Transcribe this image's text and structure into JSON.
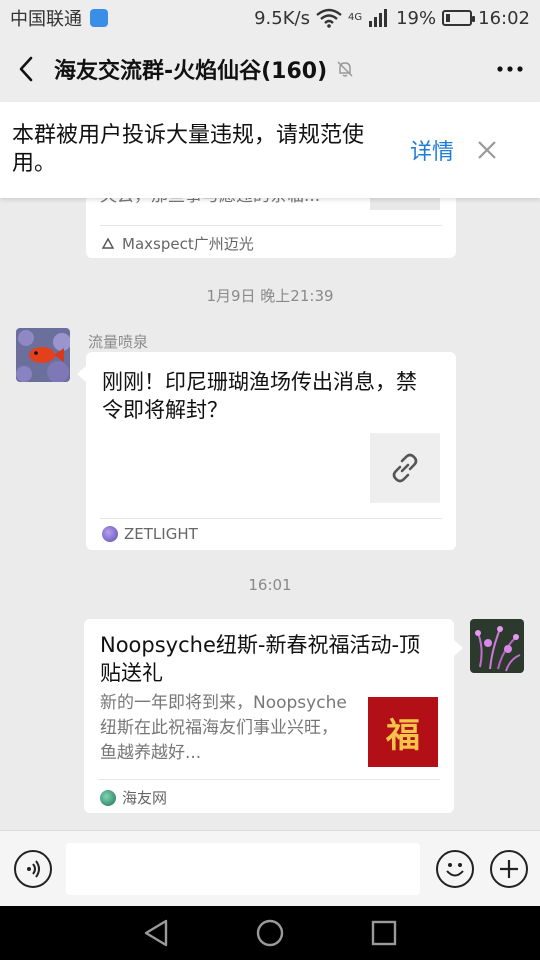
{
  "status_bar": {
    "carrier": "中国联通",
    "speed": "9.5K/s",
    "network": "4G",
    "battery": "19%",
    "battery_level": 0.19,
    "time": "16:02"
  },
  "header": {
    "title": "海友交流群-火焰仙谷(160)"
  },
  "banner": {
    "text": "本群被用户投诉大量违规，请规范使用。",
    "detail_label": "详情"
  },
  "messages": {
    "card0": {
      "desc_partial": "失去，那些事与愿违的亲临...",
      "source": "Maxspect广州迈光"
    },
    "time1": "1月9日 晚上21:39",
    "msg1": {
      "sender": "流量喷泉",
      "title": "刚刚！印尼珊瑚渔场传出消息，禁令即将解封？",
      "source": "ZETLIGHT"
    },
    "time2": "16:01",
    "msg2": {
      "title": "Noopsyche纽斯-新春祝福活动-顶贴送礼",
      "desc": "新的一年即将到来，Noopsyche纽斯在此祝福海友们事业兴旺，鱼越养越好...",
      "thumb_char": "福",
      "source": "海友网"
    }
  },
  "colors": {
    "accent": "#1f7cd6",
    "background": "#ebebeb"
  }
}
